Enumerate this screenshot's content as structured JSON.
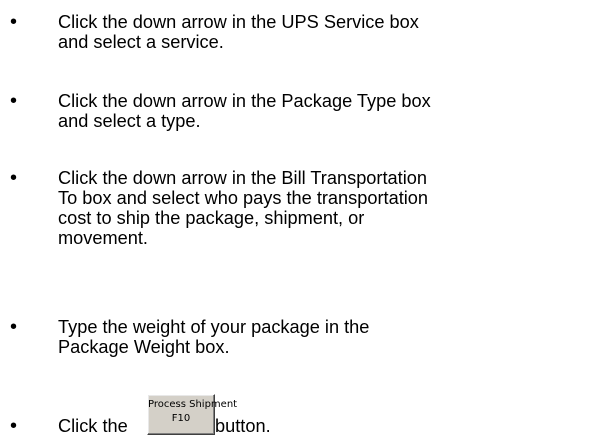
{
  "instructions": [
    {
      "bullet": "•",
      "text": "Click the down arrow in the UPS Service box\nand select a service."
    },
    {
      "bullet": "•",
      "text": "Click the down arrow in the Package Type box\nand select a type."
    },
    {
      "bullet": "•",
      "text": "Click the down arrow in the Bill Transportation\nTo box and select who pays the transportation\ncost to ship the package, shipment, or\nmovement."
    },
    {
      "bullet": "•",
      "text": "Type the weight of your package in the\nPackage Weight box."
    }
  ],
  "final_step": {
    "bullet": "•",
    "prefix": "Click the",
    "suffix": "button.",
    "button": {
      "line1": "Process Shipment",
      "line2": "F10"
    }
  }
}
